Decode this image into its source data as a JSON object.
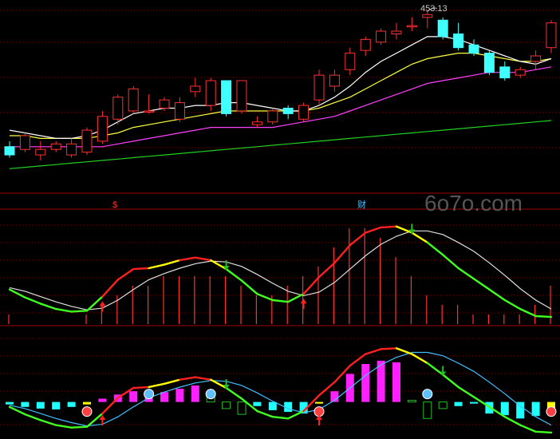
{
  "watermark": "6o7o.com",
  "price_label": "453.13",
  "panel1_markers": [
    "$",
    "财"
  ],
  "colors": {
    "background": "#000000",
    "grid": "#7a0000",
    "up_candle": "#ff3030",
    "down_candle": "#40ffff",
    "ma_white": "#ffffff",
    "ma_yellow": "#ffff40",
    "ma_magenta": "#ff40ff",
    "ma_green": "#20d020",
    "osc_red": "#ff2020",
    "osc_yellow": "#ffff00",
    "osc_green": "#40ff20",
    "signal_white": "#e0e0e0",
    "signal_cyan": "#40c0ff",
    "hist_magenta": "#ff20ff",
    "hist_cyan": "#20ffff",
    "hist_green": "#20c020",
    "arrow_up": "#ff2020",
    "arrow_down": "#20c020",
    "watermark": "#555555"
  },
  "chart_data": [
    {
      "type": "candlestick",
      "panel": "price",
      "x": [
        0,
        1,
        2,
        3,
        4,
        5,
        6,
        7,
        8,
        9,
        10,
        11,
        12,
        13,
        14,
        15,
        16,
        17,
        18,
        19,
        20,
        21,
        22,
        23,
        24,
        25,
        26,
        27,
        28,
        29,
        30,
        31,
        32,
        33,
        34,
        35
      ],
      "open": [
        404,
        403,
        401,
        403,
        401,
        402,
        406,
        414,
        417,
        417,
        418,
        414,
        424,
        419,
        428,
        417,
        412,
        413,
        418,
        414,
        421,
        426,
        432,
        439,
        442,
        445,
        448,
        451,
        450,
        445,
        441,
        438,
        433,
        430,
        435,
        440
      ],
      "close": [
        401,
        408,
        403,
        405,
        405,
        410,
        415,
        422,
        425,
        417,
        421,
        420,
        426,
        428,
        416,
        428,
        413,
        417,
        416,
        419,
        430,
        430,
        438,
        443,
        446,
        446,
        448,
        452,
        444,
        440,
        438,
        431,
        429,
        432,
        437,
        449
      ],
      "high": [
        406,
        409,
        406,
        406,
        407,
        411,
        417,
        423,
        426,
        423,
        422,
        422,
        429,
        429,
        427,
        428,
        415,
        418,
        419,
        420,
        432,
        432,
        440,
        444,
        447,
        449,
        451,
        453.13,
        451,
        449,
        443,
        439,
        435,
        433,
        439,
        450
      ],
      "low": [
        400,
        402,
        399,
        402,
        400,
        401,
        405,
        412,
        416,
        416,
        417,
        413,
        422,
        417,
        415,
        416,
        411,
        412,
        414,
        413,
        419,
        424,
        430,
        437,
        441,
        443,
        446,
        447,
        443,
        439,
        437,
        430,
        428,
        429,
        432,
        438
      ],
      "ma_white": [
        410,
        409,
        408,
        407,
        407,
        408,
        410,
        413,
        416,
        417,
        418,
        418,
        419,
        419,
        420,
        420,
        419,
        418,
        417,
        417,
        419,
        422,
        426,
        431,
        435,
        438,
        441,
        444,
        444,
        443,
        441,
        439,
        437,
        435,
        434,
        436
      ],
      "ma_yellow": [
        408,
        408,
        407,
        407,
        407,
        407,
        408,
        409,
        411,
        412,
        413,
        414,
        415,
        416,
        417,
        417,
        417,
        417,
        417,
        417,
        418,
        420,
        422,
        425,
        428,
        431,
        434,
        436,
        437,
        438,
        438,
        437,
        436,
        435,
        435,
        436
      ],
      "ma_magenta": [
        404,
        404,
        404,
        404,
        404,
        404,
        404,
        405,
        406,
        407,
        408,
        409,
        410,
        411,
        411,
        411,
        411,
        411,
        412,
        413,
        414,
        415,
        417,
        419,
        421,
        423,
        425,
        427,
        428,
        429,
        430,
        431,
        431,
        431,
        432,
        433
      ],
      "ma_green": [
        396,
        396.5,
        397,
        397.5,
        398,
        398.5,
        399,
        399.5,
        400,
        400.5,
        401,
        401.5,
        402,
        402.5,
        403,
        403.5,
        404,
        404.5,
        405,
        405.5,
        406,
        406.5,
        407,
        407.5,
        408,
        408.5,
        409,
        409.5,
        410,
        410.5,
        411,
        411.5,
        412,
        412.5,
        413,
        413.5
      ],
      "ylim": [
        390,
        455
      ]
    },
    {
      "type": "line+bar",
      "panel": "oscillator-1",
      "x": [
        0,
        1,
        2,
        3,
        4,
        5,
        6,
        7,
        8,
        9,
        10,
        11,
        12,
        13,
        14,
        15,
        16,
        17,
        18,
        19,
        20,
        21,
        22,
        23,
        24,
        25,
        26,
        27,
        28,
        29,
        30,
        31,
        32,
        33,
        34,
        35
      ],
      "main_line": [
        -6,
        -15,
        -22,
        -28,
        -31,
        -30,
        -14,
        5,
        17,
        18,
        22,
        27,
        30,
        27,
        17,
        4,
        -11,
        -18,
        -20,
        -11,
        8,
        24,
        44,
        58,
        64,
        65,
        58,
        47,
        33,
        18,
        6,
        -6,
        -18,
        -28,
        -36,
        -37
      ],
      "signal_line": [
        -4,
        -8,
        -14,
        -20,
        -25,
        -29,
        -27,
        -18,
        -6,
        5,
        12,
        18,
        23,
        26,
        25,
        20,
        11,
        1,
        -8,
        -13,
        -9,
        2,
        17,
        32,
        45,
        54,
        60,
        60,
        56,
        47,
        37,
        24,
        10,
        -5,
        -18,
        -28
      ],
      "line_color_segments": [
        "green",
        "green",
        "green",
        "green",
        "green",
        "green",
        "red",
        "red",
        "red",
        "yellow",
        "yellow",
        "red",
        "red",
        "yellow",
        "green",
        "green",
        "green",
        "green",
        "green",
        "red",
        "red",
        "red",
        "red",
        "red",
        "red",
        "yellow",
        "yellow",
        "green",
        "green",
        "green",
        "green",
        "green",
        "green",
        "green",
        "green",
        "yellow"
      ],
      "bars": [
        1,
        0,
        0,
        0,
        0,
        1,
        2,
        3,
        4,
        4,
        5,
        5,
        5,
        5,
        5,
        4,
        3,
        3,
        4,
        5,
        6,
        8,
        10,
        10,
        9,
        7,
        5,
        3,
        2,
        2,
        1,
        1,
        1,
        1,
        2,
        4
      ],
      "signals": [
        {
          "index": 6,
          "kind": "up"
        },
        {
          "index": 14,
          "kind": "down"
        },
        {
          "index": 19,
          "kind": "up"
        },
        {
          "index": 26,
          "kind": "down"
        }
      ],
      "ylim": [
        -45,
        72
      ]
    },
    {
      "type": "line+bar",
      "panel": "oscillator-2",
      "x": [
        0,
        1,
        2,
        3,
        4,
        5,
        6,
        7,
        8,
        9,
        10,
        11,
        12,
        13,
        14,
        15,
        16,
        17,
        18,
        19,
        20,
        21,
        22,
        23,
        24,
        25,
        26,
        27,
        28,
        29,
        30,
        31,
        32,
        33,
        34,
        35
      ],
      "main_line": [
        -6,
        -15,
        -22,
        -28,
        -31,
        -30,
        -14,
        5,
        17,
        18,
        22,
        27,
        30,
        27,
        17,
        4,
        -11,
        -18,
        -20,
        -11,
        8,
        24,
        44,
        58,
        64,
        65,
        58,
        47,
        33,
        18,
        6,
        -6,
        -18,
        -28,
        -36,
        -37
      ],
      "signal_line": [
        -4,
        -8,
        -14,
        -20,
        -25,
        -29,
        -27,
        -18,
        -6,
        5,
        12,
        18,
        23,
        26,
        25,
        20,
        11,
        1,
        -8,
        -13,
        -9,
        2,
        17,
        32,
        45,
        54,
        60,
        60,
        56,
        47,
        37,
        24,
        10,
        -5,
        -18,
        -28
      ],
      "line_color_segments": [
        "green",
        "green",
        "green",
        "green",
        "green",
        "green",
        "red",
        "red",
        "red",
        "yellow",
        "yellow",
        "red",
        "red",
        "yellow",
        "green",
        "green",
        "green",
        "green",
        "green",
        "red",
        "red",
        "red",
        "red",
        "red",
        "red",
        "yellow",
        "yellow",
        "green",
        "green",
        "green",
        "green",
        "green",
        "green",
        "green",
        "green",
        "yellow"
      ],
      "hist": [
        -3,
        -6,
        -8,
        -9,
        -6,
        -3,
        4,
        9,
        13,
        13,
        12,
        16,
        20,
        7,
        -8,
        -15,
        -5,
        -10,
        -12,
        -14,
        -2,
        13,
        34,
        46,
        50,
        48,
        2,
        -20,
        -8,
        -5,
        -2,
        -14,
        -16,
        -20,
        -17,
        -8
      ],
      "hist_colors": [
        "cyan",
        "cyan",
        "cyan",
        "cyan",
        "cyan",
        "yellow",
        "magenta",
        "magenta",
        "magenta",
        "magenta",
        "magenta",
        "magenta",
        "magenta",
        "green-hollow",
        "green-hollow",
        "green-hollow",
        "cyan",
        "cyan",
        "cyan",
        "cyan",
        "yellow",
        "magenta",
        "magenta",
        "magenta",
        "magenta",
        "magenta",
        "green-hollow",
        "green-hollow",
        "green-hollow",
        "cyan",
        "cyan",
        "cyan",
        "cyan",
        "cyan",
        "cyan",
        "yellow"
      ],
      "balls": [
        {
          "index": 5,
          "kind": "red"
        },
        {
          "index": 9,
          "kind": "blue"
        },
        {
          "index": 13,
          "kind": "blue"
        },
        {
          "index": 20,
          "kind": "red"
        },
        {
          "index": 27,
          "kind": "blue"
        },
        {
          "index": 35,
          "kind": "red"
        }
      ],
      "signals": [
        {
          "index": 6,
          "kind": "up"
        },
        {
          "index": 14,
          "kind": "down"
        },
        {
          "index": 20,
          "kind": "up"
        },
        {
          "index": 28,
          "kind": "down"
        }
      ],
      "ylim": [
        -40,
        75
      ]
    }
  ]
}
